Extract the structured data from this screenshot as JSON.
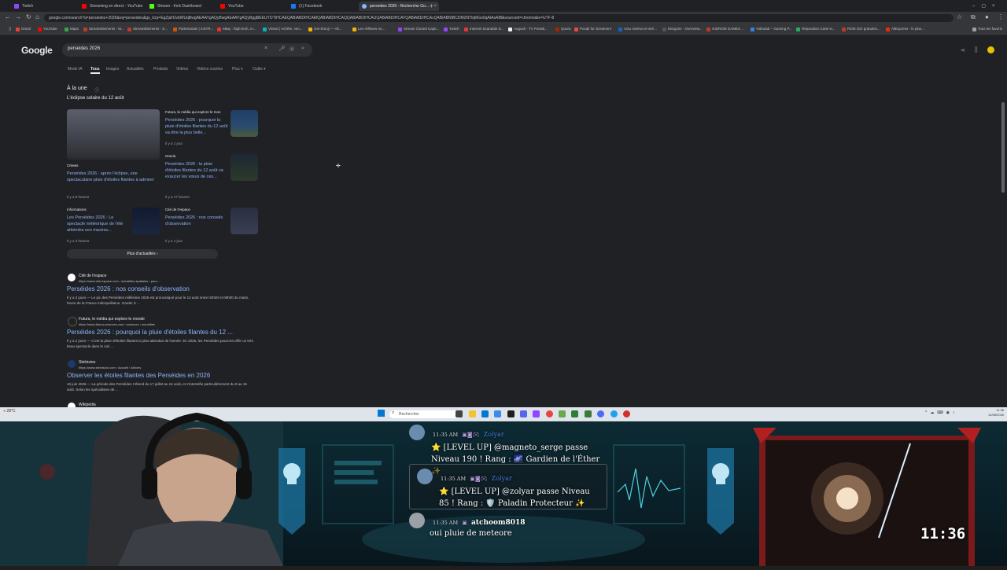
{
  "browser": {
    "tabs": [
      {
        "label": "Twitch",
        "color": "#9146ff"
      },
      {
        "label": "Streaming en direct - YouTube",
        "color": "#ff0000"
      },
      {
        "label": "Stream - Kick Dashboard",
        "color": "#53fc18"
      },
      {
        "label": "YouTube",
        "color": "#ff0000"
      },
      {
        "label": "(1) Facebook",
        "color": "#1877f2"
      },
      {
        "label": "perseides 2026 - Recherche Go...",
        "color": "#8ab4f8"
      }
    ],
    "url": "google.com/search?q=perseides+2026&oq=perseides&gs_lcrp=EgZjaHJvbWUqBwgAEAAYgAQyBwgAEAAYgAQyBggBEEUYOTIHCAEQABiABDIHCAMQABiABDIHCAQQABiABDIHCAUQABiABDIHCAYQABiABDIHCAcQABiABNIBCDM2NTlqMGo0qAIAsAIB&sourceid=chrome&ie=UTF-8",
    "bookmarks": [
      "Gmail",
      "YouTube",
      "Maps",
      "StreamElements - M...",
      "StreamElements - S...",
      "Partenariats | mSTR...",
      "eBay : high-tech, m...",
      "Vinted | Achète, ven...",
      "Get Emoji — All...",
      "Les réflexes en...",
      "Stream Closed Capti...",
      "Twitch",
      "Internet Scandale D...",
      "Augusti - TV Portab...",
      "Quora",
      "Pocali for streamers",
      "Actu cinéma et séri...",
      "Elorgsim - Overview...",
      "GIDROM GAMES ...",
      "Videolab – Gaming P...",
      "Réparation Carte in...",
      "ROM ISO gratuites...",
      "AliExpress - le plus...",
      "Tous les favoris"
    ]
  },
  "google": {
    "logo": "Google",
    "query": "perseides 2026",
    "tabs": [
      "Mode IA",
      "Tous",
      "Images",
      "Actualités",
      "Produits",
      "Vidéos",
      "Vidéos courtes",
      "Plus ▾",
      "Outils ▾"
    ],
    "top_stories": {
      "heading": "À la une",
      "subheading": "L'éclipse solaire du 12 août",
      "items": [
        {
          "source": "CNews",
          "title": "Perséides 2026 : après l'éclipse, une spectaculaire pluie d'étoiles filantes à admirer",
          "time": "Il y a 8 heures",
          "thumb": "#6b6f78"
        },
        {
          "source": "Futura, le média qui explore le mon",
          "title": "Perséides 2026 : pourquoi la pluie d'étoiles filantes du 12 août va être la plus belle...",
          "time": "Il y a 1 jour",
          "thumb": "#2b4a6e"
        },
        {
          "source": "Grazia",
          "title": "Perséides 2026 : la pluie d'étoiles filantes du 12 août va exaucer les vœux de ces...",
          "time": "Il y a 17 heures",
          "thumb": "#2d3a2a"
        },
        {
          "source": "Informations",
          "title": "Les Perséides 2026 : Le spectacle météorique de l'été atteindra son maximu...",
          "time": "Il y a 3 heures",
          "thumb": "#1b2640"
        },
        {
          "source": "Cité de l'espace",
          "title": "Perséides 2026 : nos conseils d'observation",
          "time": "Il y a 1 jour",
          "thumb": "#3a3f55"
        }
      ],
      "more": "Plus d'actualités  ›"
    },
    "results": [
      {
        "site": "Cité de l'espace",
        "url": "https://www.cite-espace.com › actualites-spatiales › pers...",
        "title": "Perséides 2026 : nos conseils d'observation",
        "snippet": "Il y a 2 jours — Le pic des Perséides millésime 2026 est pronostiqué pour le 13 août entre 04h00 et 06h00 du matin, heure de la France métropolitaine. Garder à ..."
      },
      {
        "site": "Futura, le média qui explore le monde",
        "url": "https://www.futura-sciences.com › sciences › actualites",
        "title": "Perséides 2026 : pourquoi la pluie d'étoiles filantes du 12 ...",
        "snippet": "Il y a 2 jours — C'est la pluie d'étoiles filantes la plus attendue de l'année. En 2026, les Perséides pourront offrir un très beau spectacle dans le ciel ..."
      },
      {
        "site": "Stelvision",
        "url": "https://www.stelvision.com › Accueil › Articles",
        "title": "Observer les étoiles filantes des Perséides en 2026",
        "snippet": "16 juin 2026 — La période des Perséides s'étend du 17 juillet au 24 août, et s'intensifie particulièrement du 9 au 15 août. Selon les spécialistes de ..."
      }
    ],
    "partial_site": "Wikipédia"
  },
  "taskbar": {
    "search_placeholder": "Rechercher",
    "weather": "28°C",
    "time": "11:36",
    "date": "12/08/2026"
  },
  "chat": [
    {
      "time": "11:35 AM",
      "user": "Zolyar",
      "text": "⭐ [LEVEL UP] @magneto_serge passe Niveau 190 ! Rang : 🌌 Gardien de l'Éther ✨"
    },
    {
      "time": "11:35 AM",
      "user": "Zolyar",
      "text": "⭐ [LEVEL UP] @zolyar passe Niveau 85 ! Rang : 🛡️ Paladin Protecteur ✨"
    },
    {
      "time": "11:35 AM",
      "user": "atchoom8018",
      "text": "oui pluie de meteore"
    }
  ],
  "clock": "11:36"
}
